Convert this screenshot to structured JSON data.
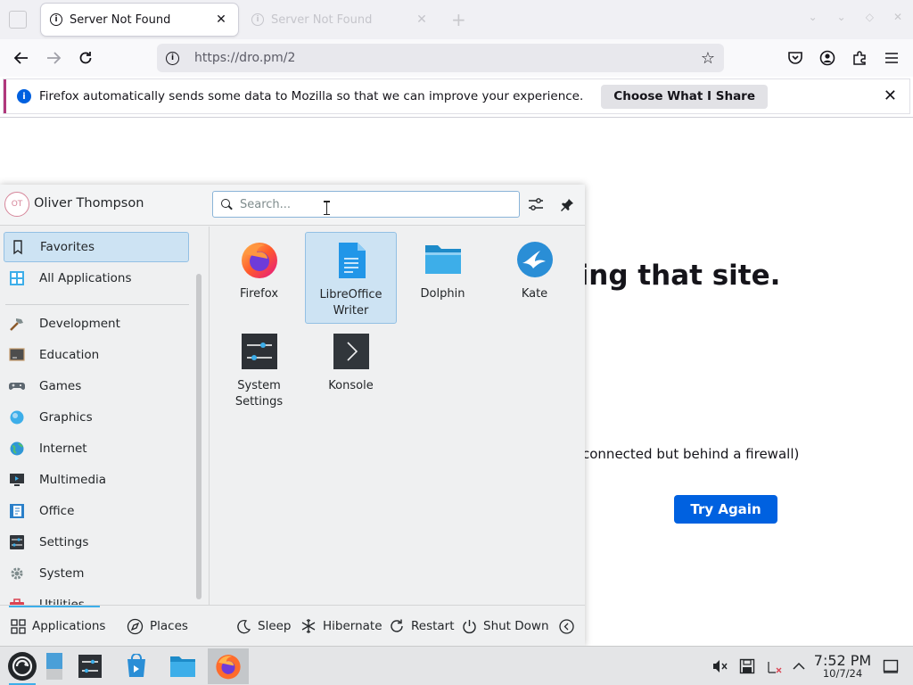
{
  "browser": {
    "tabs": [
      {
        "title": "Server Not Found",
        "active": true
      },
      {
        "title": "Server Not Found",
        "active": false
      }
    ],
    "url": "https://dro.pm/2",
    "notification": {
      "text": "Firefox automatically sends some data to Mozilla so that we can improve your experience.",
      "button": "Choose What I Share"
    }
  },
  "page": {
    "heading_fragment": "ling that site.",
    "bullet_fragment": "connected but behind a firewall)",
    "try_again": "Try Again"
  },
  "launcher": {
    "user": {
      "name": "Oliver Thompson",
      "initials": "OT"
    },
    "search": {
      "placeholder": "Search..."
    },
    "sidebar": {
      "items": [
        {
          "label": "Favorites",
          "icon": "bookmark-icon",
          "selected": true
        },
        {
          "label": "All Applications",
          "icon": "grid-icon"
        },
        {
          "label": "Development",
          "icon": "hammer-icon"
        },
        {
          "label": "Education",
          "icon": "chalkboard-icon"
        },
        {
          "label": "Games",
          "icon": "gamepad-icon"
        },
        {
          "label": "Graphics",
          "icon": "graphics-icon"
        },
        {
          "label": "Internet",
          "icon": "globe-icon"
        },
        {
          "label": "Multimedia",
          "icon": "multimedia-icon"
        },
        {
          "label": "Office",
          "icon": "office-icon"
        },
        {
          "label": "Settings",
          "icon": "settings-icon"
        },
        {
          "label": "System",
          "icon": "gear-icon"
        },
        {
          "label": "Utilities",
          "icon": "toolbox-icon"
        }
      ]
    },
    "apps": [
      {
        "label": "Firefox",
        "icon": "firefox-icon"
      },
      {
        "label": "LibreOffice Writer",
        "icon": "writer-icon",
        "selected": true
      },
      {
        "label": "Dolphin",
        "icon": "folder-icon"
      },
      {
        "label": "Kate",
        "icon": "kate-icon"
      },
      {
        "label": "System Settings",
        "icon": "sliders-icon"
      },
      {
        "label": "Konsole",
        "icon": "terminal-icon"
      }
    ],
    "footer": {
      "applications": "Applications",
      "places": "Places",
      "sleep": "Sleep",
      "hibernate": "Hibernate",
      "restart": "Restart",
      "shutdown": "Shut Down"
    }
  },
  "taskbar": {
    "time": "7:52 PM",
    "date": "10/7/24"
  },
  "colors": {
    "accent": "#3daee9",
    "selection_bg": "#cde3f3",
    "firefox_blue": "#0061e0"
  }
}
